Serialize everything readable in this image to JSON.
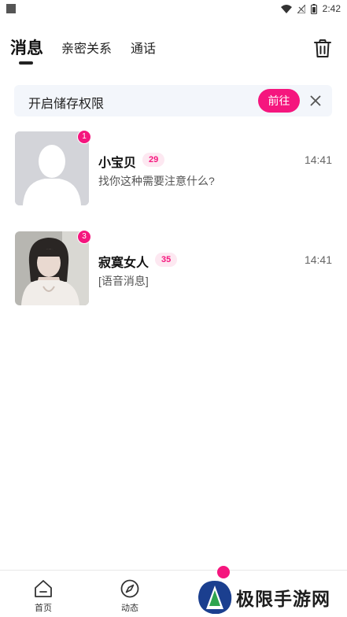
{
  "status_bar": {
    "time": "2:42"
  },
  "header": {
    "tabs": [
      {
        "label": "消息",
        "active": true
      },
      {
        "label": "亲密关系",
        "active": false
      },
      {
        "label": "通话",
        "active": false
      }
    ],
    "trash_icon": "trash-icon"
  },
  "banner": {
    "text": "开启储存权限",
    "button_label": "前往",
    "close_icon": "close-icon"
  },
  "conversations": [
    {
      "unread": "1",
      "name": "小宝贝",
      "age": "29",
      "time": "14:41",
      "preview": "找你这种需要注意什么?",
      "avatar": "default-silhouette"
    },
    {
      "unread": "3",
      "name": "寂寞女人",
      "age": "35",
      "time": "14:41",
      "preview": "[语音消息]",
      "avatar": "photo"
    }
  ],
  "bottom_nav": {
    "items": [
      {
        "label": "首页",
        "icon": "home-icon"
      },
      {
        "label": "动态",
        "icon": "compass-icon"
      }
    ]
  },
  "watermark": {
    "text": "极限手游网"
  },
  "colors": {
    "accent": "#f5167e",
    "banner_bg": "#f3f6fb",
    "badge_bg": "#fde8f1"
  }
}
